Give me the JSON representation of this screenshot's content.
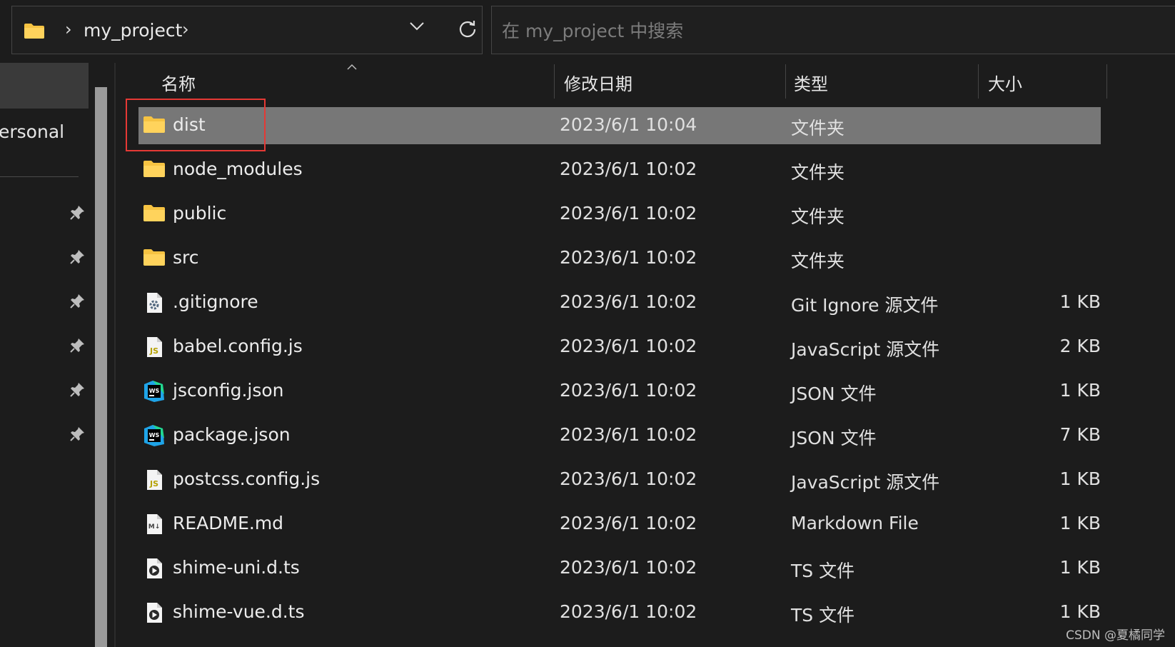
{
  "address_bar": {
    "crumb": "my_project"
  },
  "search": {
    "placeholder": "在 my_project 中搜索"
  },
  "nav": {
    "partial_label": "ersonal"
  },
  "columns": {
    "name": "名称",
    "date": "修改日期",
    "type": "类型",
    "size": "大小"
  },
  "files": [
    {
      "name": "dist",
      "date": "2023/6/1 10:04",
      "type": "文件夹",
      "size": "",
      "icon": "folder-icon",
      "selected": true
    },
    {
      "name": "node_modules",
      "date": "2023/6/1 10:02",
      "type": "文件夹",
      "size": "",
      "icon": "folder-icon"
    },
    {
      "name": "public",
      "date": "2023/6/1 10:02",
      "type": "文件夹",
      "size": "",
      "icon": "folder-icon"
    },
    {
      "name": "src",
      "date": "2023/6/1 10:02",
      "type": "文件夹",
      "size": "",
      "icon": "folder-icon"
    },
    {
      "name": ".gitignore",
      "date": "2023/6/1 10:02",
      "type": "Git Ignore 源文件",
      "size": "1 KB",
      "icon": "gear-file-icon"
    },
    {
      "name": "babel.config.js",
      "date": "2023/6/1 10:02",
      "type": "JavaScript 源文件",
      "size": "2 KB",
      "icon": "js-file-icon"
    },
    {
      "name": "jsconfig.json",
      "date": "2023/6/1 10:02",
      "type": "JSON 文件",
      "size": "1 KB",
      "icon": "webstorm-icon"
    },
    {
      "name": "package.json",
      "date": "2023/6/1 10:02",
      "type": "JSON 文件",
      "size": "7 KB",
      "icon": "webstorm-icon"
    },
    {
      "name": "postcss.config.js",
      "date": "2023/6/1 10:02",
      "type": "JavaScript 源文件",
      "size": "1 KB",
      "icon": "js-file-icon"
    },
    {
      "name": "README.md",
      "date": "2023/6/1 10:02",
      "type": "Markdown File",
      "size": "1 KB",
      "icon": "markdown-file-icon"
    },
    {
      "name": "shime-uni.d.ts",
      "date": "2023/6/1 10:02",
      "type": "TS 文件",
      "size": "1 KB",
      "icon": "media-file-icon"
    },
    {
      "name": "shime-vue.d.ts",
      "date": "2023/6/1 10:02",
      "type": "TS 文件",
      "size": "1 KB",
      "icon": "media-file-icon"
    }
  ],
  "watermark": "CSDN @夏橘同学",
  "colors": {
    "background": "#1c1c1c",
    "selected_row": "#777777",
    "highlight_box": "#e53935",
    "folder": "#f6c342"
  }
}
